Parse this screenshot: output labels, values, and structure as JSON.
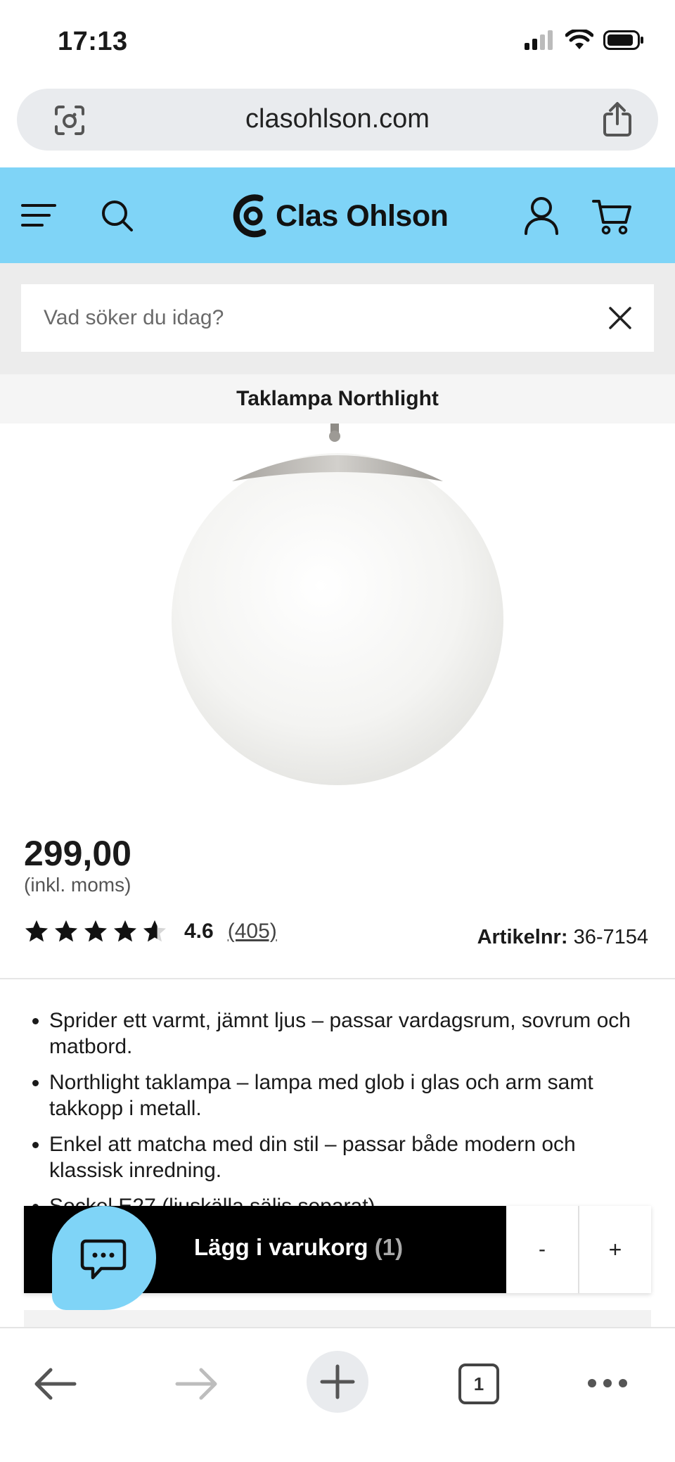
{
  "status_bar": {
    "time": "17:13"
  },
  "browser": {
    "url": "clasohlson.com",
    "tab_count": "1"
  },
  "header": {
    "brand": "Clas Ohlson",
    "colors": {
      "header_bg": "#7fd4f7",
      "accent": "#000000"
    }
  },
  "search": {
    "placeholder": "Vad söker du idag?",
    "value": ""
  },
  "product": {
    "title": "Taklampa Northlight",
    "price": "299,00",
    "vat_note": "(inkl. moms)",
    "rating": "4.6",
    "rating_fraction": 0.92,
    "review_count": "(405)",
    "article_label": "Artikelnr:",
    "article_number": "36-7154",
    "bullets": [
      "Sprider ett varmt, jämnt ljus – passar vardagsrum, sovrum och matbord.",
      "Northlight taklampa – lampa med glob i glas och arm samt takkopp i metall.",
      "Enkel att matcha med din stil – passar både modern och klassisk inredning.",
      "Sockel E27 (ljuskälla säljs separat)."
    ]
  },
  "cart_bar": {
    "add_label": "Lägg i varukorg",
    "count": "(1)",
    "minus": "-",
    "plus": "+"
  },
  "icons": {
    "menu": "hamburger-menu-icon",
    "search": "search-icon",
    "user": "user-icon",
    "cart": "cart-icon",
    "chat": "chat-icon"
  }
}
